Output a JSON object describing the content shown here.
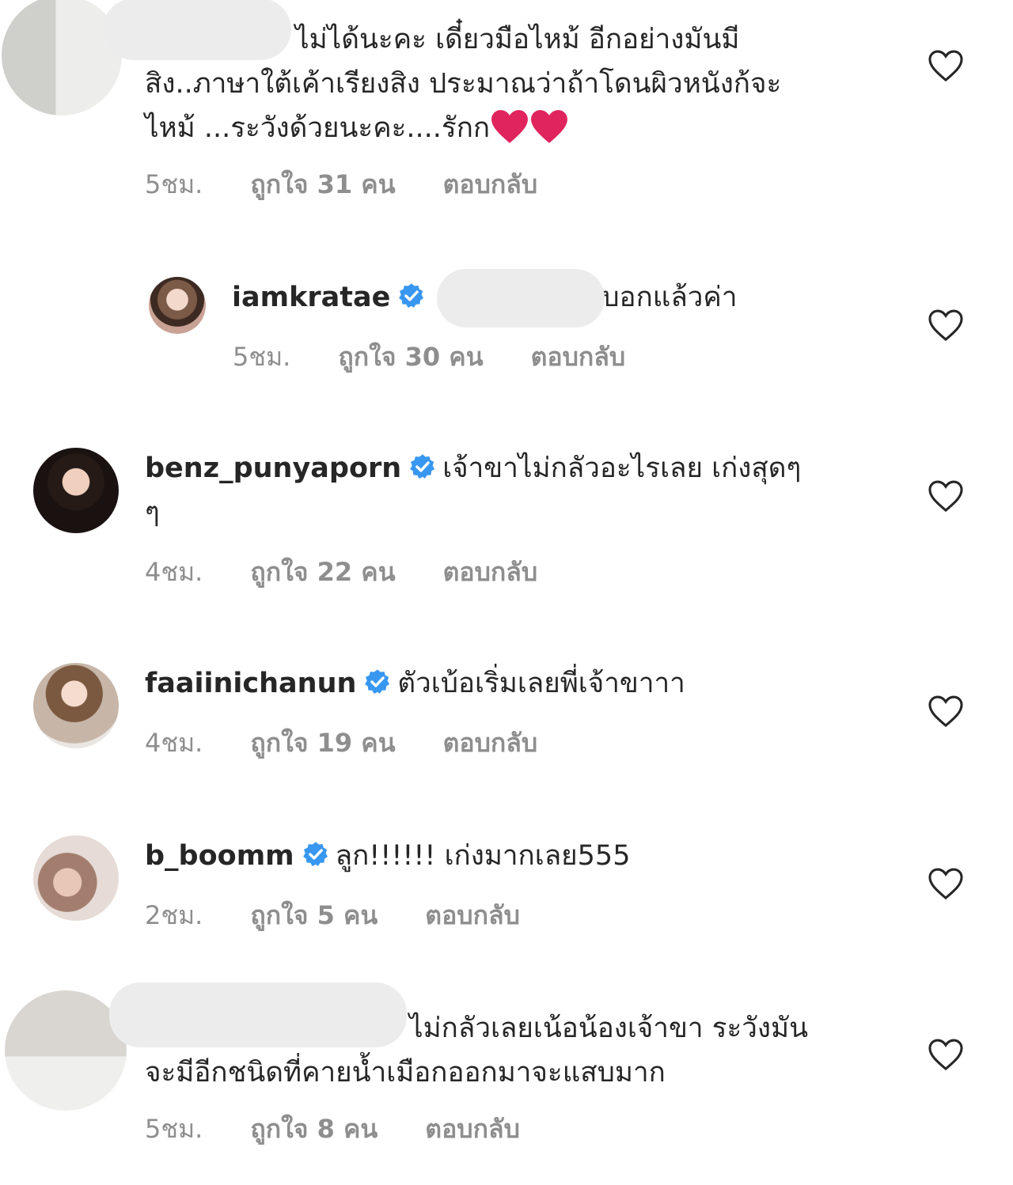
{
  "comments": [
    {
      "username": "",
      "text_lines": [
        "ไม่ได้นะคะ เดี๋ยวมือไหม้ อีกอย่างมันมี",
        "สิง..ภาษาใต้เค้าเรียงสิง ประมาณว่าถ้าโดนผิวหนังก้จะ",
        "ไหม้ ...ระวังด้วยนะคะ....รักก"
      ],
      "time": "5ชม.",
      "likes": "ถูกใจ 31 คน",
      "reply": "ตอบกลับ"
    },
    {
      "username": "iamkratae",
      "text": "บอกแล้วค่า",
      "time": "5ชม.",
      "likes": "ถูกใจ 30 คน",
      "reply": "ตอบกลับ"
    },
    {
      "username": "benz_punyaporn",
      "text_lines": [
        "เจ้าขาไม่กลัวอะไรเลย เก่งสุดๆ",
        "ๆ"
      ],
      "time": "4ชม.",
      "likes": "ถูกใจ 22 คน",
      "reply": "ตอบกลับ"
    },
    {
      "username": "faaiinichanun",
      "text": "ตัวเบ้อเริ่มเลยพี่เจ้าขาาา",
      "time": "4ชม.",
      "likes": "ถูกใจ 19 คน",
      "reply": "ตอบกลับ"
    },
    {
      "username": "b_boomm",
      "text": "ลูก!!!!!! เก่งมากเลย555",
      "time": "2ชม.",
      "likes": "ถูกใจ 5 คน",
      "reply": "ตอบกลับ"
    },
    {
      "username": "",
      "text_lines": [
        "ไม่กลัวเลยเน้อน้องเจ้าขา ระวังมัน",
        "จะมีอีกชนิดที่คายน้ำเมือกออกมาจะแสบมาก"
      ],
      "time": "5ชม.",
      "likes": "ถูกใจ 8 คน",
      "reply": "ตอบกลับ"
    }
  ],
  "colors": {
    "text": "#262626",
    "meta": "#8e8e8e",
    "verified": "#3897f0",
    "emoji_heart": "#e0245e"
  },
  "icons": {
    "like": "heart-outline-icon",
    "verified": "verified-badge-icon",
    "emoji": "red-heart-emoji-icon"
  }
}
